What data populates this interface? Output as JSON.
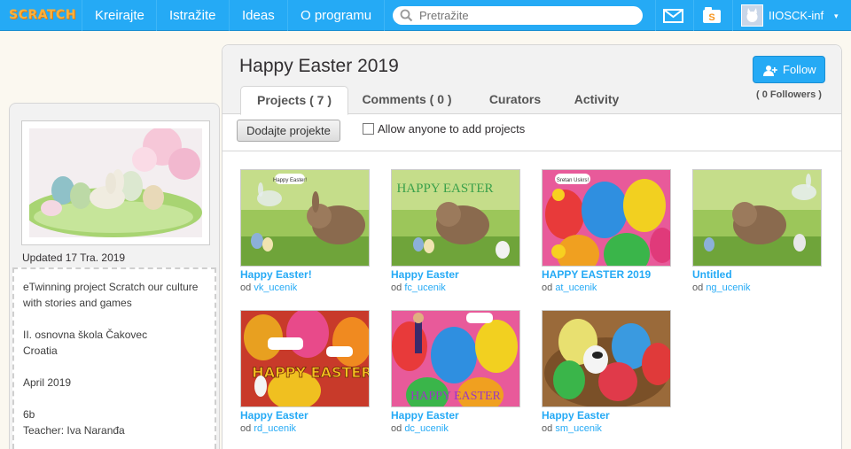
{
  "nav": {
    "logo": "SCRATCH",
    "items": [
      "Kreirajte",
      "Istražite",
      "Ideas",
      "O programu"
    ],
    "search_placeholder": "Pretražite",
    "username": "IIOSCK-inf",
    "caret": "▾"
  },
  "sidebar": {
    "updated": "Updated 17 Tra. 2019",
    "description": [
      "eTwinning project Scratch our culture with stories and games",
      "",
      "II. osnovna škola Čakovec",
      "Croatia",
      "",
      "April 2019",
      "",
      "6b",
      "Teacher: Iva Naranđa"
    ]
  },
  "studio": {
    "title": "Happy Easter 2019",
    "follow_label": "Follow",
    "followers": "( 0 Followers )",
    "tabs": [
      "Projects ( 7 )",
      "Comments ( 0 )",
      "Curators",
      "Activity"
    ],
    "add_projects_label": "Dodajte projekte",
    "allow_label": "Allow anyone to add projects"
  },
  "projects": [
    {
      "title": "Happy Easter!",
      "by": "od",
      "user": "vk_ucenik",
      "thumb_caption": "Happy Easter!"
    },
    {
      "title": "Happy Easter",
      "by": "od",
      "user": "fc_ucenik",
      "thumb_caption": "HAPPY EASTER"
    },
    {
      "title": "HAPPY EASTER 2019",
      "by": "od",
      "user": "at_ucenik",
      "thumb_caption": "Sretan Uskrs!"
    },
    {
      "title": "Untitled",
      "by": "od",
      "user": "ng_ucenik",
      "thumb_caption": ""
    },
    {
      "title": "Happy Easter",
      "by": "od",
      "user": "rd_ucenik",
      "thumb_caption": "HAPPY EASTER"
    },
    {
      "title": "Happy Easter",
      "by": "od",
      "user": "dc_ucenik",
      "thumb_caption": "HAPPY EASTER"
    },
    {
      "title": "Happy Easter",
      "by": "od",
      "user": "sm_ucenik",
      "thumb_caption": ""
    }
  ],
  "colors": {
    "accent": "#25aaf5",
    "page_bg": "#fbf8f0"
  }
}
